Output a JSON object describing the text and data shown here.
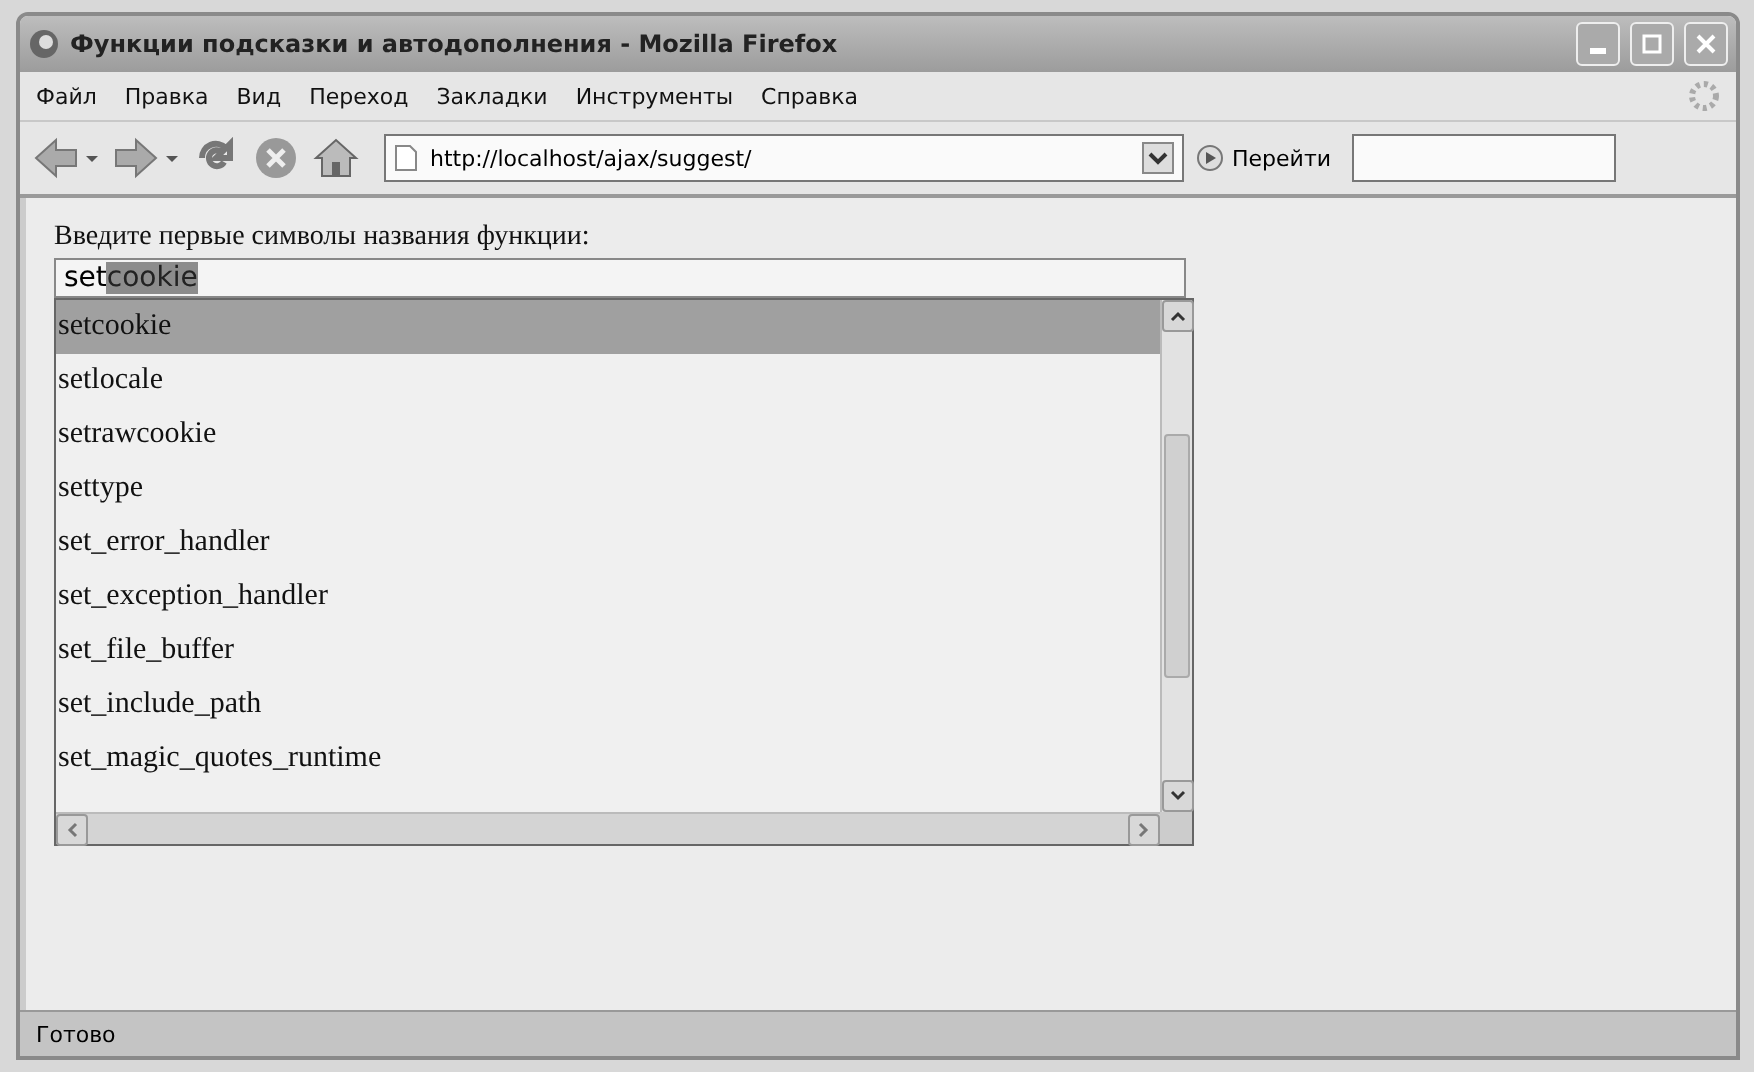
{
  "window": {
    "title": "Функции подсказки и автодополнения - Mozilla Firefox"
  },
  "menu": [
    "Файл",
    "Правка",
    "Вид",
    "Переход",
    "Закладки",
    "Инструменты",
    "Справка"
  ],
  "toolbar": {
    "address": "http://localhost/ajax/suggest/",
    "go_label": "Перейти"
  },
  "page": {
    "prompt": "Введите первые символы названия функции:",
    "field": {
      "typed": "set",
      "completion": "cookie"
    },
    "suggestions": [
      {
        "label": "setcookie",
        "selected": true
      },
      {
        "label": "setlocale",
        "selected": false
      },
      {
        "label": "setrawcookie",
        "selected": false
      },
      {
        "label": "settype",
        "selected": false
      },
      {
        "label": "set_error_handler",
        "selected": false
      },
      {
        "label": "set_exception_handler",
        "selected": false
      },
      {
        "label": "set_file_buffer",
        "selected": false
      },
      {
        "label": "set_include_path",
        "selected": false
      },
      {
        "label": "set_magic_quotes_runtime",
        "selected": false
      }
    ]
  },
  "status_bar": "Готово"
}
